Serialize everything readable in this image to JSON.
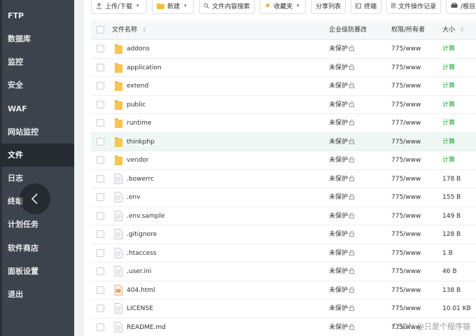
{
  "sidebar": {
    "items": [
      {
        "label": "FTP"
      },
      {
        "label": "数据库"
      },
      {
        "label": "监控"
      },
      {
        "label": "安全"
      },
      {
        "label": "WAF"
      },
      {
        "label": "网站监控"
      },
      {
        "label": "文件",
        "active": true
      },
      {
        "label": "日志"
      },
      {
        "label": "终端"
      },
      {
        "label": "计划任务"
      },
      {
        "label": "软件商店"
      },
      {
        "label": "面板设置"
      },
      {
        "label": "退出"
      }
    ]
  },
  "toolbar": {
    "upload_label": "上传/下载",
    "new_label": "新建",
    "search_content_label": "文件内容搜索",
    "favorites_label": "收藏夹",
    "share_label": "分享列表",
    "terminal_label": "终端",
    "oplog_label": "文件操作记录",
    "root_label": "/根目"
  },
  "table": {
    "headers": {
      "name": "文件名称",
      "protect": "企业级防篡改",
      "perm": "权限/所有者",
      "size": "大小"
    },
    "rows": [
      {
        "name": "addons",
        "type": "folder",
        "protect": "未保护",
        "perm": "775/www",
        "size": "计算"
      },
      {
        "name": "application",
        "type": "folder",
        "protect": "未保护",
        "perm": "775/www",
        "size": "计算"
      },
      {
        "name": "extend",
        "type": "folder",
        "protect": "未保护",
        "perm": "775/www",
        "size": "计算"
      },
      {
        "name": "public",
        "type": "folder",
        "protect": "未保护",
        "perm": "775/www",
        "size": "计算"
      },
      {
        "name": "runtime",
        "type": "folder",
        "protect": "未保护",
        "perm": "777/www",
        "size": "计算"
      },
      {
        "name": "thinkphp",
        "type": "folder",
        "protect": "未保护",
        "perm": "775/www",
        "size": "计算",
        "highlighted": true
      },
      {
        "name": "vendor",
        "type": "folder",
        "protect": "未保护",
        "perm": "775/www",
        "size": "计算"
      },
      {
        "name": ".bowerrc",
        "type": "file",
        "protect": "未保护",
        "perm": "775/www",
        "size": "178 B"
      },
      {
        "name": ".env",
        "type": "file",
        "protect": "未保护",
        "perm": "775/www",
        "size": "155 B"
      },
      {
        "name": ".env.sample",
        "type": "file",
        "protect": "未保护",
        "perm": "775/www",
        "size": "149 B"
      },
      {
        "name": ".gitignore",
        "type": "file",
        "protect": "未保护",
        "perm": "775/www",
        "size": "128 B"
      },
      {
        "name": ".htaccess",
        "type": "file",
        "protect": "未保护",
        "perm": "775/www",
        "size": "1 B"
      },
      {
        "name": ".user.ini",
        "type": "file",
        "protect": "未保护",
        "perm": "775/www",
        "size": "46 B"
      },
      {
        "name": "404.html",
        "type": "html",
        "protect": "未保护",
        "perm": "775/www",
        "size": "138 B"
      },
      {
        "name": "LICENSE",
        "type": "file",
        "protect": "未保护",
        "perm": "775/www",
        "size": "10.01 KB"
      },
      {
        "name": "README.md",
        "type": "file",
        "protect": "未保护",
        "perm": "775/www",
        "size": ""
      }
    ]
  },
  "watermark": "CSDN @只是个程序猿",
  "colors": {
    "sidebar_bg": "#3c434c",
    "sidebar_active": "#262b31",
    "accent_green": "#20a53a",
    "folder_yellow": "#f5bd3c",
    "row_highlight": "#eef7f4"
  }
}
